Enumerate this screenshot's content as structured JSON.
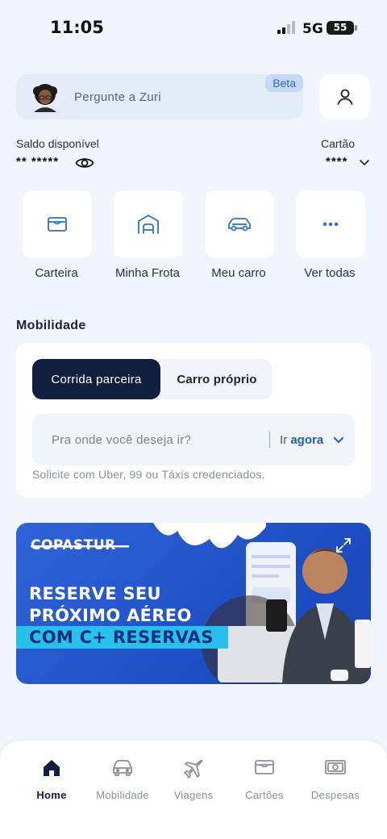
{
  "status_bar": {
    "time": "11:05",
    "network": "5G",
    "battery": "55"
  },
  "assistant": {
    "placeholder": "Pergunte a Zuri",
    "badge": "Beta"
  },
  "balance": {
    "label": "Saldo disponível",
    "value": "** *****"
  },
  "card": {
    "label": "Cartão",
    "value": "****"
  },
  "shortcuts": [
    {
      "label": "Carteira",
      "icon": "wallet-icon"
    },
    {
      "label": "Minha Frota",
      "icon": "garage-icon"
    },
    {
      "label": "Meu carro",
      "icon": "car-icon"
    },
    {
      "label": "Ver todas",
      "icon": "more-icon"
    }
  ],
  "mobility": {
    "title": "Mobilidade",
    "tabs": [
      "Corrida parceira",
      "Carro próprio"
    ],
    "destination_placeholder": "Pra onde você deseja ir?",
    "when_prefix": "Ir",
    "when_value": "agora",
    "hint": "Solicite com Uber, 99 ou Táxis credenciados."
  },
  "banner": {
    "brand": "COPASTUR",
    "line1": "RESERVE SEU",
    "line2": "PRÓXIMO AÉREO",
    "line3": "COM C+ RESERVAS"
  },
  "nav": [
    {
      "label": "Home",
      "icon": "home-icon",
      "active": true
    },
    {
      "label": "Mobilidade",
      "icon": "car-icon",
      "active": false
    },
    {
      "label": "Viagens",
      "icon": "plane-icon",
      "active": false
    },
    {
      "label": "Cartões",
      "icon": "card-icon",
      "active": false
    },
    {
      "label": "Despesas",
      "icon": "money-icon",
      "active": false
    }
  ],
  "colors": {
    "primary": "#0f1f3d",
    "accent": "#1d5db8",
    "icon": "#2f6fd0",
    "background": "#f2f5fd"
  }
}
